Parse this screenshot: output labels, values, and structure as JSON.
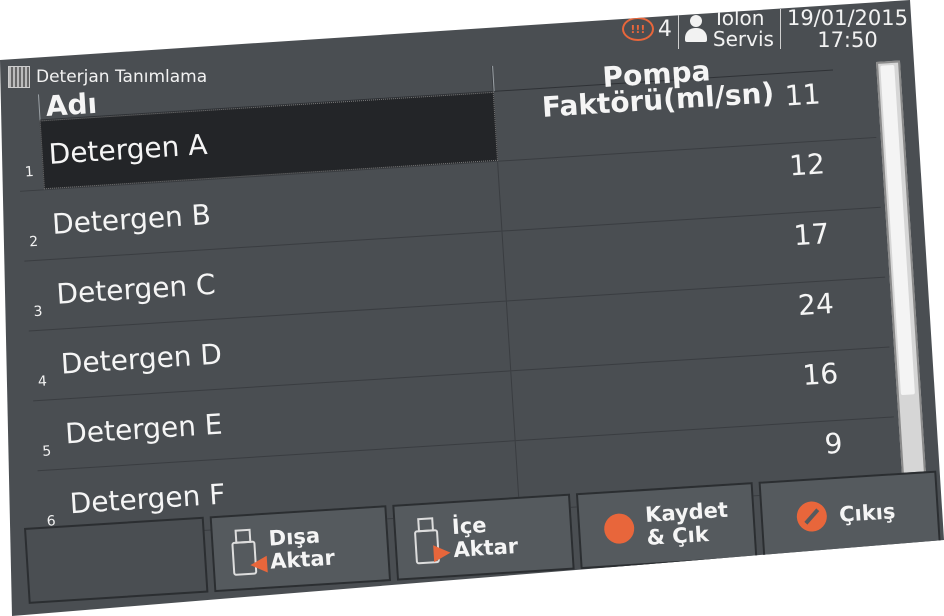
{
  "status": {
    "alarm_count": "4",
    "alarm_icon_text": "!!!",
    "user_line1": "Tolon",
    "user_line2": "Servis",
    "date": "19/01/2015",
    "time": "17:50"
  },
  "page": {
    "title": "Deterjan Tanımlama"
  },
  "table": {
    "col_name": "Adı",
    "col_pump": "Pompa Faktörü(ml/sn)",
    "rows": [
      {
        "num": "1",
        "name": "Detergen A",
        "pump": "11"
      },
      {
        "num": "2",
        "name": "Detergen B",
        "pump": "12"
      },
      {
        "num": "3",
        "name": "Detergen C",
        "pump": "17"
      },
      {
        "num": "4",
        "name": "Detergen D",
        "pump": "24"
      },
      {
        "num": "5",
        "name": "Detergen E",
        "pump": "16"
      },
      {
        "num": "6",
        "name": "Detergen F",
        "pump": "9"
      }
    ]
  },
  "buttons": {
    "export_line1": "Dışa",
    "export_line2": "Aktar",
    "import_line1": "İçe",
    "import_line2": "Aktar",
    "save_line1": "Kaydet",
    "save_line2": "& Çık",
    "exit": "Çıkış"
  },
  "colors": {
    "accent": "#e8663b",
    "panel": "#4a4e52",
    "selected": "#232528"
  }
}
